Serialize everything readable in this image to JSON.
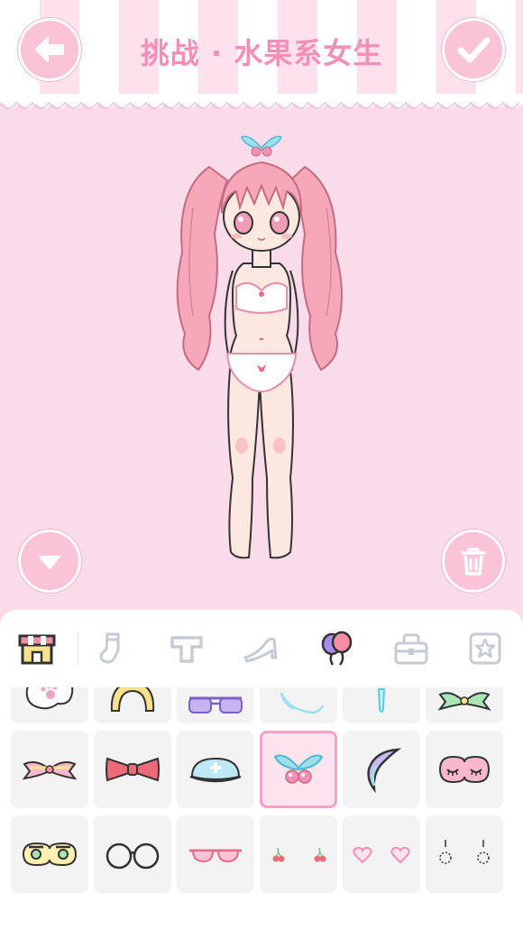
{
  "header": {
    "title": "挑战 · 水果系女生",
    "back_icon": "arrow-left-icon",
    "confirm_icon": "check-icon"
  },
  "stage": {
    "collapse_icon": "chevron-down-icon",
    "delete_icon": "trash-icon"
  },
  "toolbar": {
    "tabs": [
      {
        "icon": "shop-icon",
        "selected": false
      },
      {
        "icon": "sock-icon",
        "selected": false
      },
      {
        "icon": "top-icon",
        "selected": false
      },
      {
        "icon": "high-heel-icon",
        "selected": false
      },
      {
        "icon": "balloon-icon",
        "selected": true
      },
      {
        "icon": "bag-icon",
        "selected": false
      },
      {
        "icon": "star-badge-icon",
        "selected": false
      }
    ]
  },
  "items": [
    {
      "name": "fluffy-paw-item"
    },
    {
      "name": "yellow-headband-item"
    },
    {
      "name": "purple-sunglasses-item"
    },
    {
      "name": "blue-scarf-item"
    },
    {
      "name": "blue-drop-item"
    },
    {
      "name": "green-bow-item"
    },
    {
      "name": "pink-hair-bow-item"
    },
    {
      "name": "red-bowtie-item"
    },
    {
      "name": "nurse-cap-item"
    },
    {
      "name": "cherry-clip-item",
      "selected": true
    },
    {
      "name": "crescent-moon-item"
    },
    {
      "name": "sleep-mask-item"
    },
    {
      "name": "yellow-eye-mask-item"
    },
    {
      "name": "round-glasses-item"
    },
    {
      "name": "pink-glasses-item"
    },
    {
      "name": "cherry-earrings-item"
    },
    {
      "name": "heart-earrings-item"
    },
    {
      "name": "chain-earrings-item"
    }
  ],
  "colors": {
    "accent": "#f48fb7",
    "background": "#f9dbe9",
    "button": "#fbc3d7",
    "selected_border": "#f6a2c4"
  }
}
